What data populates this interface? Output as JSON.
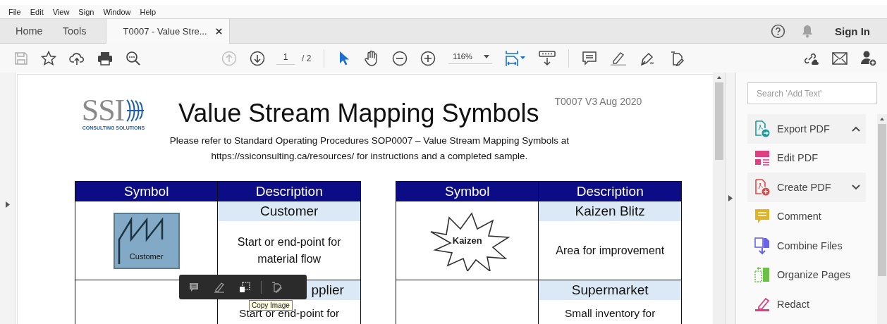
{
  "menu": [
    "File",
    "Edit",
    "View",
    "Sign",
    "Window",
    "Help"
  ],
  "tabs": [
    {
      "label": "Home",
      "selected": false
    },
    {
      "label": "Tools",
      "selected": false
    },
    {
      "label": "T0007 - Value Stre...",
      "selected": true,
      "kind": "document"
    }
  ],
  "account": {
    "sign_in": "Sign In"
  },
  "toolbar": {
    "previous_page": {
      "disabled": true
    },
    "next_page": {
      "disabled": false
    },
    "page_number": "1",
    "page_count": "/ 2",
    "tools": [
      {
        "selected": true
      },
      {
        "selected": false
      }
    ],
    "zoom": "116%"
  },
  "document": {
    "logo": {
      "text": "SSI",
      "tagline": "CONSULTING SOLUTIONS"
    },
    "title": "Value Stream Mapping Symbols",
    "version": "T0007 V3 Aug 2020",
    "intro": [
      "Please refer to Standard Operating Procedures SOP0007 – Value Stream Mapping Symbols at",
      "https://ssiconsulting.ca/resources/ for instructions and a completed sample."
    ],
    "tables": [
      {
        "columns": [
          "Symbol",
          "Description"
        ],
        "rows": [
          {
            "symbol_label": "Customer",
            "title": "Customer",
            "description": "Start or end-point for material flow"
          },
          {
            "title": "pplier",
            "description": "Start or end-point for"
          }
        ]
      },
      {
        "columns": [
          "Symbol",
          "Description"
        ],
        "rows": [
          {
            "symbol_label": "Kaizen",
            "title": "Kaizen Blitz",
            "description": "Area for improvement"
          },
          {
            "title": "Supermarket",
            "description": "Small inventory for"
          }
        ]
      }
    ]
  },
  "floating_toolbar": {
    "buttons": [
      {
        "hovered": false
      },
      {
        "hovered": false
      },
      {
        "hovered": true
      },
      {
        "hovered": false
      }
    ],
    "tooltip": "Copy Image"
  },
  "tools_panel": {
    "search": {
      "placeholder": "Search 'Add Text'"
    },
    "items": [
      {
        "label": "Export PDF",
        "kind": "group",
        "expanded": true,
        "color": "#1a9a9a"
      },
      {
        "label": "Edit PDF",
        "kind": "tool",
        "color": "#e0407f"
      },
      {
        "label": "Create PDF",
        "kind": "group",
        "expanded": false,
        "color": "#e04848"
      },
      {
        "label": "Comment",
        "kind": "tool",
        "color": "#e0b420"
      },
      {
        "label": "Combine Files",
        "kind": "tool",
        "color": "#6a64e8"
      },
      {
        "label": "Organize Pages",
        "kind": "tool",
        "color": "#6cc04a"
      },
      {
        "label": "Redact",
        "kind": "tool",
        "color": "#e0407f"
      }
    ]
  }
}
